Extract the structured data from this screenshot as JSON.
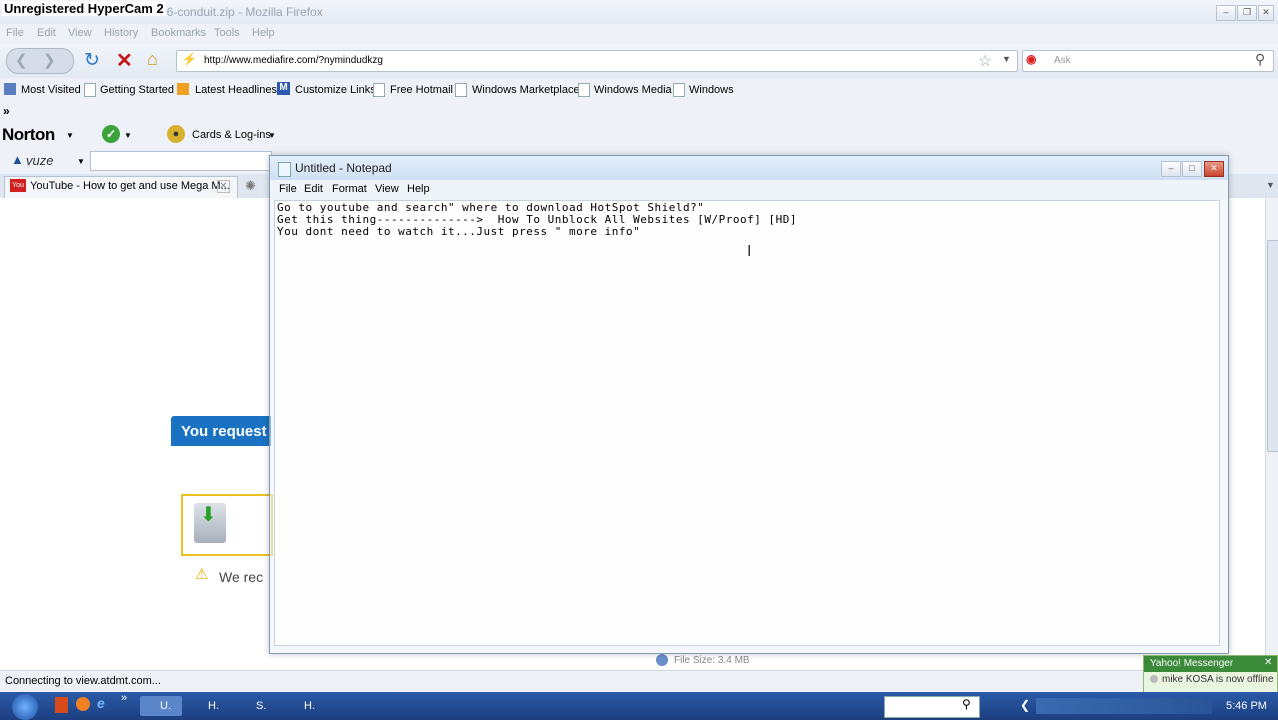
{
  "hypercam_label": "Unregistered HyperCam 2",
  "firefox": {
    "window_title": "76-conduit.zip - Mozilla Firefox",
    "menu": [
      "File",
      "Edit",
      "View",
      "History",
      "Bookmarks",
      "Tools",
      "Help"
    ],
    "url": "http://www.mediafire.com/?nymindudkzg",
    "search_placeholder": "Ask",
    "bookmarks": [
      "Most Visited",
      "Getting Started",
      "Latest Headlines",
      "Customize Links",
      "Free Hotmail",
      "Windows Marketplace",
      "Windows Media",
      "Windows"
    ],
    "chevron": "»",
    "norton_label": "Norton",
    "cards_label": "Cards & Log-ins",
    "vuze_label": "vuze",
    "tab_title": "YouTube - How to get and use Mega M...",
    "status_text": "Connecting to view.atdmt.com...",
    "page_banner": "You request",
    "page_warning": "We rec",
    "file_size": "File Size: 3.4 MB"
  },
  "notepad": {
    "title": "Untitled - Notepad",
    "menu": [
      "File",
      "Edit",
      "Format",
      "View",
      "Help"
    ],
    "lines": [
      "Go to youtube and search\" where to download HotSpot Shield?\"",
      "Get this thing-------------->  How To Unblock All Websites [W/Proof] [HD]",
      "You dont need to watch it...Just press \" more info\""
    ]
  },
  "taskbar": {
    "tasks": [
      "U.",
      "H.",
      "S.",
      "H."
    ],
    "clock": "5:46 PM"
  },
  "yahoo": {
    "title": "Yahoo! Messenger",
    "message": "mike KOSA is now offline"
  }
}
